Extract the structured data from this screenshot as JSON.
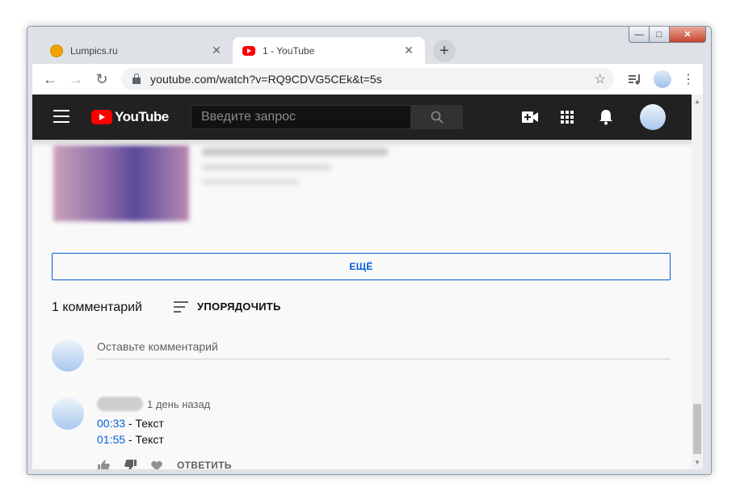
{
  "tabs": [
    {
      "title": "Lumpics.ru",
      "icon": "lumpics-favicon-icon"
    },
    {
      "title": "1 - YouTube",
      "icon": "youtube-favicon-icon",
      "active": true
    }
  ],
  "toolbar": {
    "url": "youtube.com/watch?v=RQ9CDVG5CEk&t=5s"
  },
  "youtube": {
    "logo_text": "YouTube",
    "search_placeholder": "Введите запрос"
  },
  "page": {
    "more_label": "ЕЩЁ",
    "comment_count": "1 комментарий",
    "sort_label": "УПОРЯДОЧИТЬ",
    "comment_placeholder": "Оставьте комментарий"
  },
  "comment": {
    "date": "1 день назад",
    "lines": [
      {
        "time": "00:33",
        "text": " - Текст"
      },
      {
        "time": "01:55",
        "text": " - Текст"
      }
    ],
    "reply_label": "ОТВЕТИТЬ"
  },
  "colors": {
    "accent_blue": "#065fd4",
    "yt_header": "#212121",
    "yt_red": "#ff0000"
  }
}
